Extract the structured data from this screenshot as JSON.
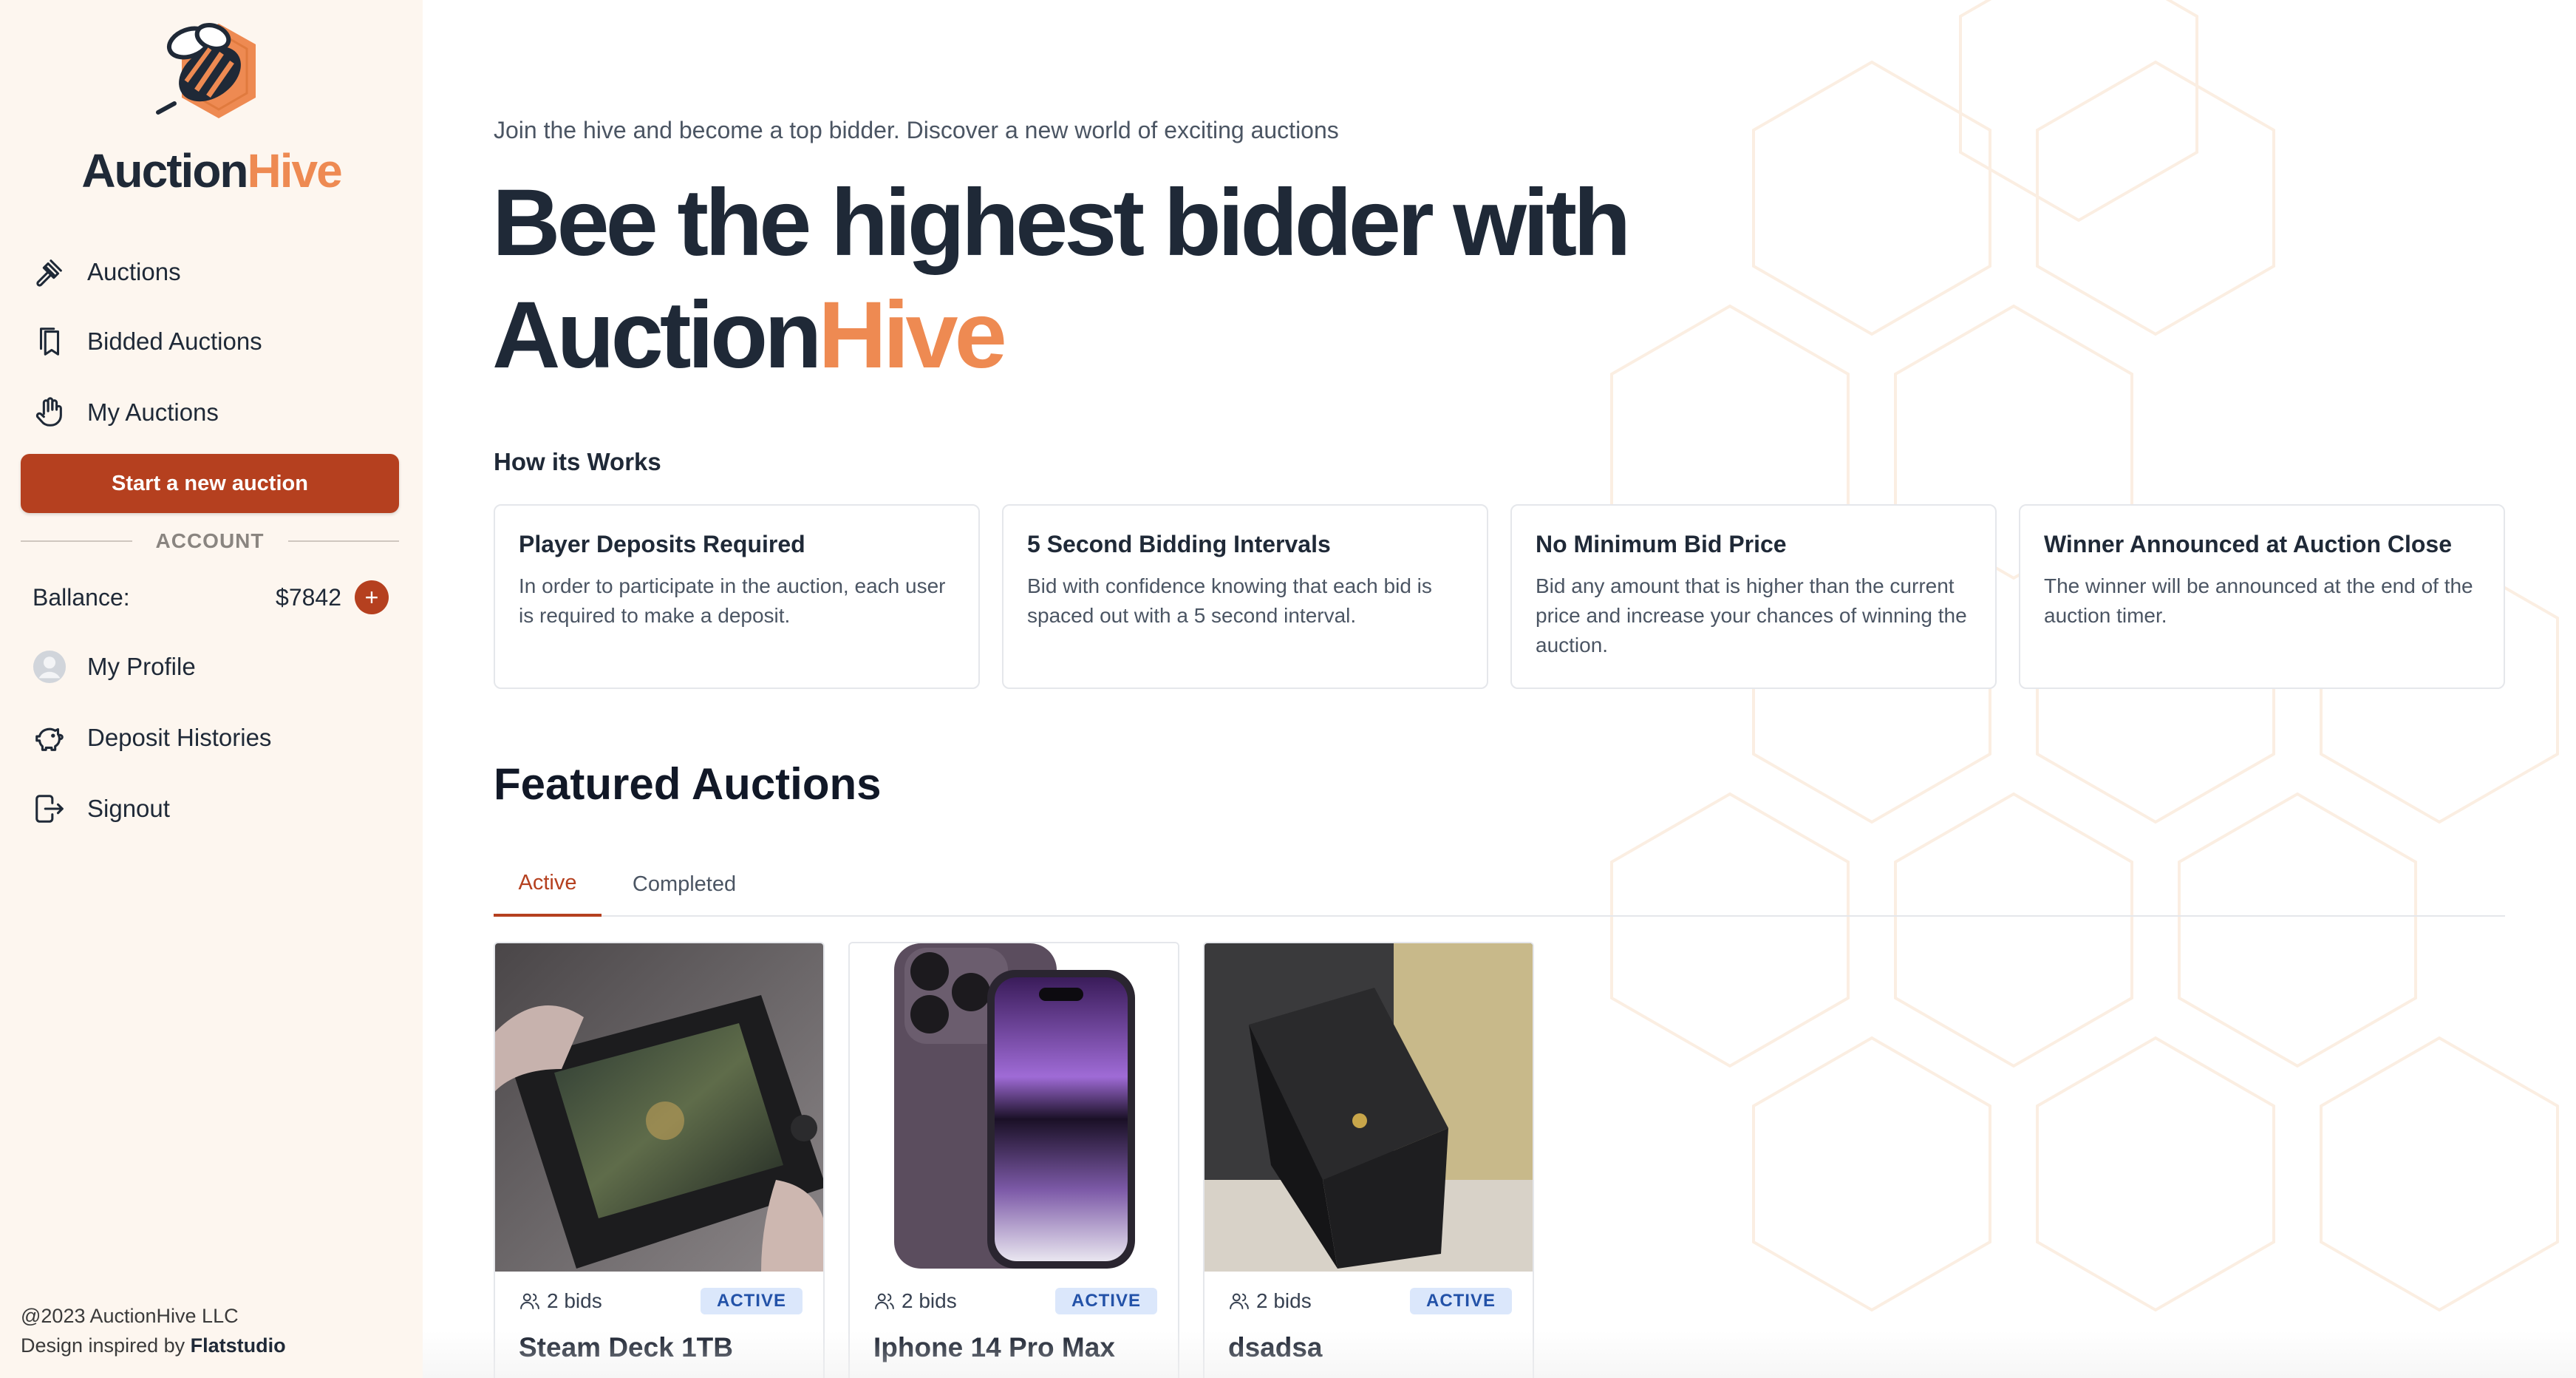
{
  "brand": {
    "name_part1": "Auction",
    "name_part2": "Hive",
    "accent_color": "#ee8a52",
    "primary_color": "#b5401f"
  },
  "sidebar": {
    "nav": [
      {
        "label": "Auctions",
        "icon": "gavel-icon"
      },
      {
        "label": "Bidded Auctions",
        "icon": "bookmark-icon"
      },
      {
        "label": "My Auctions",
        "icon": "hand-icon"
      }
    ],
    "new_auction_label": "Start a new auction",
    "account_label": "ACCOUNT",
    "balance_label": "Ballance:",
    "balance_value": "$7842",
    "add_label": "+",
    "account_items": [
      {
        "label": "My Profile",
        "icon": "avatar-icon"
      },
      {
        "label": "Deposit Histories",
        "icon": "piggy-bank-icon"
      },
      {
        "label": "Signout",
        "icon": "signout-icon"
      }
    ],
    "footer_line1": "@2023 AuctionHive LLC",
    "footer_line2_prefix": "Design inspired by",
    "footer_line2_brand": "Flatstudio"
  },
  "main": {
    "tagline": "Join the hive and become a top bidder. Discover a new world of exciting auctions",
    "hero_line1": "Bee the highest bidder with",
    "hero_line2_part1": "Auction",
    "hero_line2_part2": "Hive",
    "how_title": "How its Works",
    "cards": [
      {
        "title": "Player Deposits Required",
        "desc": "In order to participate in the auction, each user is required to make a deposit."
      },
      {
        "title": "5 Second Bidding Intervals",
        "desc": "Bid with confidence knowing that each bid is spaced out with a 5 second interval."
      },
      {
        "title": "No Minimum Bid Price",
        "desc": "Bid any amount that is higher than the current price and increase your chances of winning the auction."
      },
      {
        "title": "Winner Announced at Auction Close",
        "desc": "The winner will be announced at the end of the auction timer."
      }
    ],
    "featured_title": "Featured Auctions",
    "tabs": [
      {
        "label": "Active",
        "active": true
      },
      {
        "label": "Completed",
        "active": false
      }
    ],
    "products": [
      {
        "name": "Steam Deck 1TB",
        "bids": "2 bids",
        "status": "ACTIVE"
      },
      {
        "name": "Iphone 14 Pro Max",
        "bids": "2 bids",
        "status": "ACTIVE"
      },
      {
        "name": "dsadsa",
        "bids": "2 bids",
        "status": "ACTIVE"
      }
    ]
  }
}
